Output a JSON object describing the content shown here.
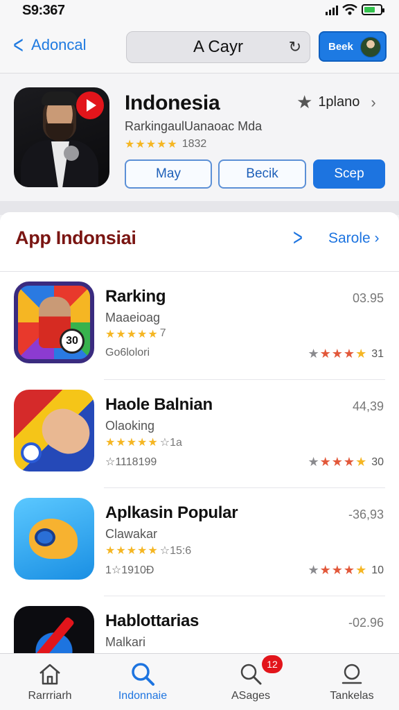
{
  "status": {
    "time": "S9:367"
  },
  "nav": {
    "back_label": "Adoncal",
    "search_text": "A Cayr",
    "profile_label": "Beek"
  },
  "feature": {
    "title": "Indonesia",
    "subtitle": "RarkingaulUanaoac Mda",
    "rating_stars": "★★★★★",
    "rating_count": "1832",
    "plano_label": "1plano",
    "buttons": [
      "May",
      "Becik",
      "Scep"
    ]
  },
  "section": {
    "title": "App Indonsiai",
    "see_all": "Sarole"
  },
  "apps": [
    {
      "name": "Rarking",
      "subtitle": "Maaeioag",
      "stars": "★★★★★",
      "rating_text": "7",
      "meta": "Go6lolori",
      "size": "03.95",
      "score": "31"
    },
    {
      "name": "Haole Balnian",
      "subtitle": "Olaoking",
      "stars": "★★★★★",
      "rating_text": "☆1a",
      "meta": "☆1118199",
      "size": "44,39",
      "score": "30"
    },
    {
      "name": "Aplkasin Popular",
      "subtitle": "Clawakar",
      "stars": "★★★★★",
      "rating_text": "☆15:6",
      "meta": "1☆1910Đ",
      "size": "-36,93",
      "score": "10"
    },
    {
      "name": "Hablottarias",
      "subtitle": "Malkari",
      "stars": "★★★★★",
      "rating_text": "",
      "meta": "",
      "size": "-02.96",
      "score": ""
    }
  ],
  "score_stars": "★★★★★",
  "tabs": [
    {
      "label": "Rarrriarh",
      "icon": "home-icon"
    },
    {
      "label": "Indonnaie",
      "icon": "search-icon"
    },
    {
      "label": "ASages",
      "icon": "search-icon",
      "badge": "12"
    },
    {
      "label": "Tankelas",
      "icon": "profile-icon"
    }
  ],
  "colors": {
    "accent": "#1d74e0",
    "section_title": "#7a1512",
    "star": "#f5b623",
    "badge": "#e2151b"
  }
}
